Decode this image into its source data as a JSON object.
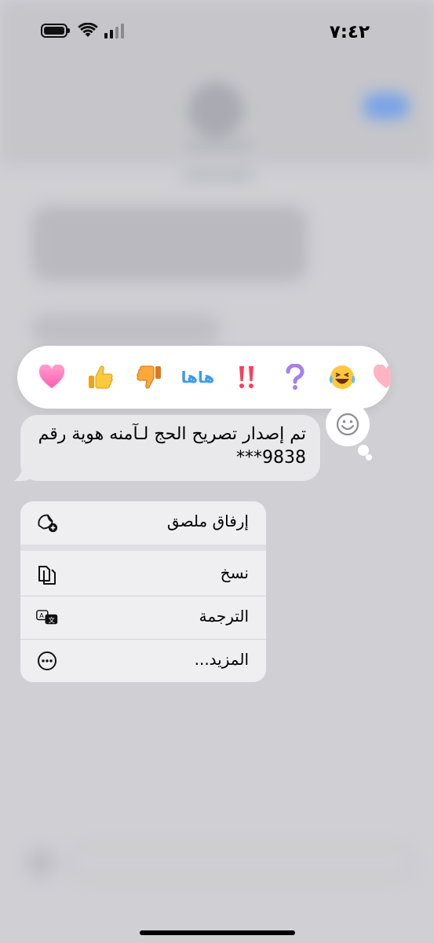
{
  "status_bar": {
    "time": "٧:٤٢",
    "battery_level": 0.9
  },
  "reactions": [
    {
      "name": "heart",
      "glyph": "💗"
    },
    {
      "name": "thumbs-up",
      "glyph": "👍"
    },
    {
      "name": "thumbs-down",
      "glyph": "👎"
    },
    {
      "name": "haha",
      "label": "هاها"
    },
    {
      "name": "exclamation",
      "glyph": "‼️"
    },
    {
      "name": "question",
      "glyph": "❓"
    },
    {
      "name": "laugh",
      "glyph": "😂"
    },
    {
      "name": "partial-heart",
      "glyph": "🩷"
    }
  ],
  "message": {
    "line1": "تم إصدار تصريح الحج لـآمنه هوية رقم",
    "line2": "***9838"
  },
  "menu": {
    "add_sticker": "إرفاق ملصق",
    "copy": "نسخ",
    "translate": "الترجمة",
    "more": "المزيد..."
  },
  "colors": {
    "accent_blue": "#3a9af5",
    "bubble_gray": "#e9e9eb"
  }
}
